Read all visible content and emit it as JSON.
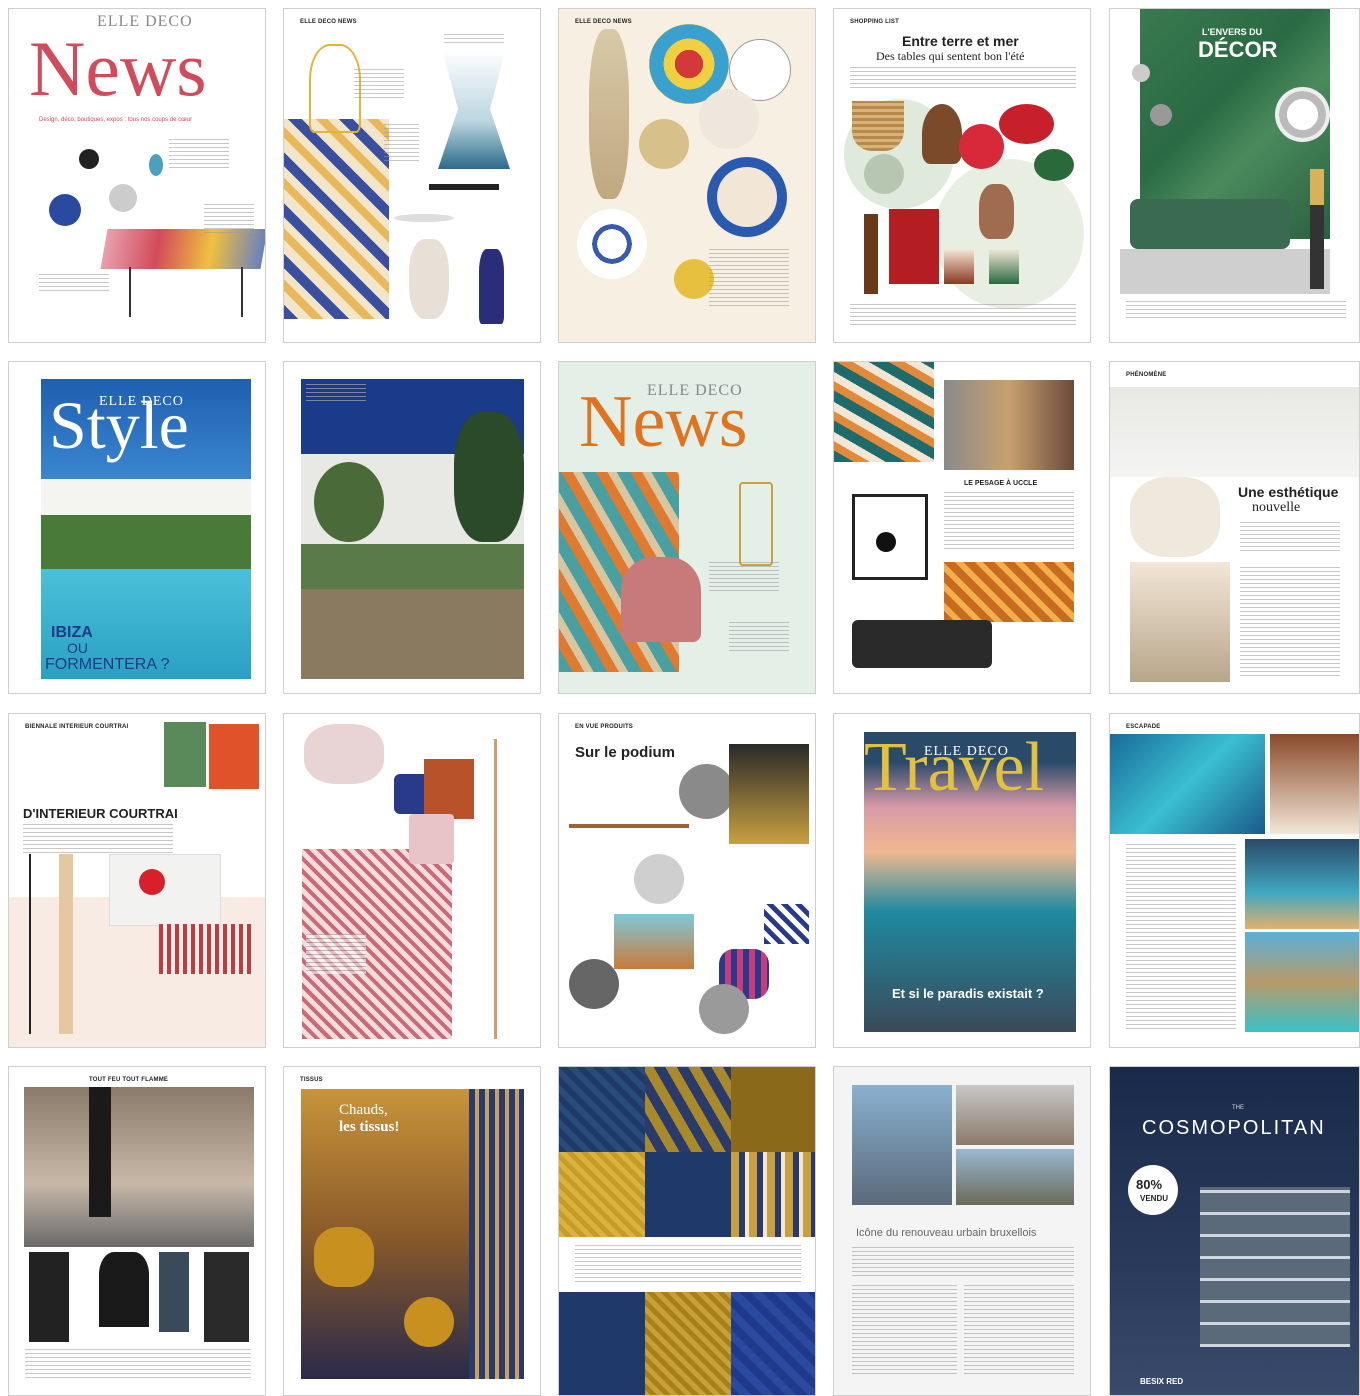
{
  "pages": [
    {
      "id": "p1",
      "masthead": "ELLE DECO",
      "title": "News",
      "subtitle": "Design, déco, boutiques, expos : tous nos coups de cœur"
    },
    {
      "id": "p2",
      "section": "ELLE DECO NEWS"
    },
    {
      "id": "p3",
      "section": "ELLE DECO NEWS"
    },
    {
      "id": "p4",
      "section": "SHOPPING LIST",
      "title": "Entre terre et mer",
      "subtitle": "Des tables qui sentent bon l'été"
    },
    {
      "id": "p5",
      "kicker": "L'ENVERS DU",
      "title": "DÉCOR"
    },
    {
      "id": "p6",
      "masthead": "ELLE DECO",
      "title": "Style",
      "cover1": "IBIZA",
      "cover2": "OU",
      "cover3": "FORMENTERA ?"
    },
    {
      "id": "p7"
    },
    {
      "id": "p8",
      "masthead": "ELLE DECO",
      "title": "News"
    },
    {
      "id": "p9",
      "caption": "LE PESAGE À UCCLE"
    },
    {
      "id": "p10",
      "section": "PHÉNOMÈNE",
      "title": "Une esthétique",
      "title2": "nouvelle"
    },
    {
      "id": "p11",
      "section": "BIENNALE INTERIEUR COURTRAI",
      "title": "D'INTERIEUR COURTRAI"
    },
    {
      "id": "p12"
    },
    {
      "id": "p13",
      "section": "EN VUE PRODUITS",
      "title": "Sur le podium"
    },
    {
      "id": "p14",
      "masthead": "ELLE DECO",
      "title": "Travel",
      "caption": "Et si le paradis existait ?"
    },
    {
      "id": "p15",
      "section": "ESCAPADE"
    },
    {
      "id": "p16",
      "section": "TOUT FEU TOUT FLAMME"
    },
    {
      "id": "p17",
      "section": "TISSUS",
      "title": "Chauds,",
      "title2": "les tissus!"
    },
    {
      "id": "p18"
    },
    {
      "id": "p19",
      "title": "Icône du renouveau urbain bruxellois"
    },
    {
      "id": "p20",
      "kicker": "THE",
      "title": "COSMOPOLITAN",
      "badge1": "80%",
      "badge2": "VENDU",
      "footer": "BESIX RED"
    }
  ]
}
